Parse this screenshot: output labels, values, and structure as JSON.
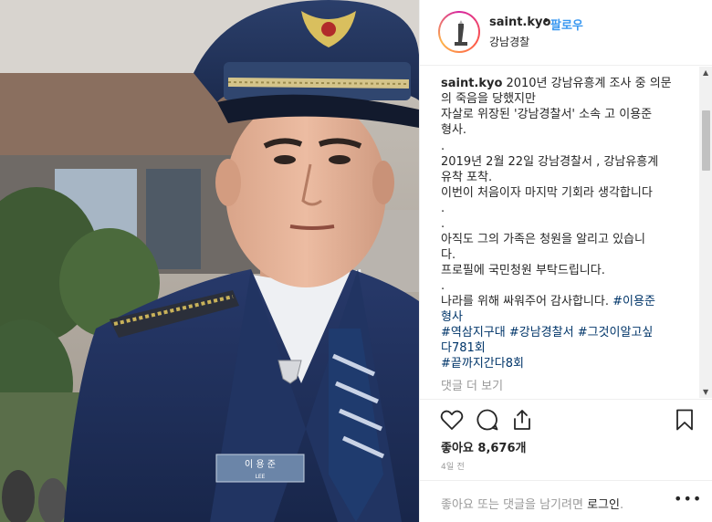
{
  "post": {
    "image_alt": "police officer portrait"
  },
  "header": {
    "username": "saint.kyo",
    "separator": "•",
    "follow_label": "팔로우",
    "location": "강남경찰"
  },
  "caption": {
    "username": "saint.kyo",
    "lines": [
      "2010년 강남유흥계 조사 중 의문",
      "의 죽음을 당했지만",
      "자살로 위장된 '강남경찰서' 소속 고 이용준",
      "형사.",
      ".",
      "2019년 2월 22일 강남경찰서 , 강남유흥계",
      "유착 포착.",
      "이번이 처음이자 마지막 기회라 생각합니다",
      ".",
      ".",
      "아직도 그의 가족은 청원을 알리고 있습니",
      "다.",
      "프로필에 국민청원 부탁드립니다.",
      ".",
      "나라를 위해 싸워주어 감사합니다."
    ],
    "hashtags": {
      "tag1": "#이용준",
      "tag1_cont": "형사",
      "tag2": "#역삼지구대",
      "tag3": "#강남경찰서",
      "tag4": "#그것이알고싶",
      "tag4_cont": "다781회",
      "tag5": "#끝까지간다8회"
    },
    "more_replies": "댓글 더 보기"
  },
  "actions": {
    "like_icon": "heart-icon",
    "comment_icon": "comment-icon",
    "share_icon": "share-icon",
    "save_icon": "bookmark-icon",
    "likes_text": "좋아요 8,676개",
    "time_text": "4일 전"
  },
  "comment_bar": {
    "prompt": "좋아요 또는 댓글을 남기려면 ",
    "login": "로그인",
    "period": ".",
    "more_icon": "•••"
  },
  "colors": {
    "link": "#003569",
    "follow": "#3897f0",
    "muted": "#999999"
  }
}
